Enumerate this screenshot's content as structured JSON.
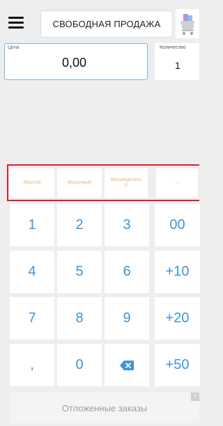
{
  "header": {
    "mode_label": "СВОБОДНАЯ ПРОДАЖА"
  },
  "price": {
    "label": "Цена",
    "value": "0,00"
  },
  "quantity": {
    "label": "Количество",
    "value": "1"
  },
  "categories": [
    {
      "label": "Мясной"
    },
    {
      "label": "Молочный"
    },
    {
      "label": "Виноводочный"
    },
    {
      "label": "..."
    }
  ],
  "keypad": {
    "k1": "1",
    "k2": "2",
    "k3": "3",
    "k00": "00",
    "k4": "4",
    "k5": "5",
    "k6": "6",
    "kplus10": "+10",
    "k7": "7",
    "k8": "8",
    "k9": "9",
    "kplus20": "+20",
    "kcomma": ",",
    "k0": "0",
    "kbackspace_icon": "backspace-icon",
    "kplus50": "+50"
  },
  "footer": {
    "deferred_orders_label": "Отложенные заказы",
    "deferred_count": "0"
  },
  "colors": {
    "accent_blue": "#3e95d6",
    "category_text": "#f0b27d",
    "highlight_frame": "#e0202a",
    "price_border": "#7cb2e0"
  }
}
